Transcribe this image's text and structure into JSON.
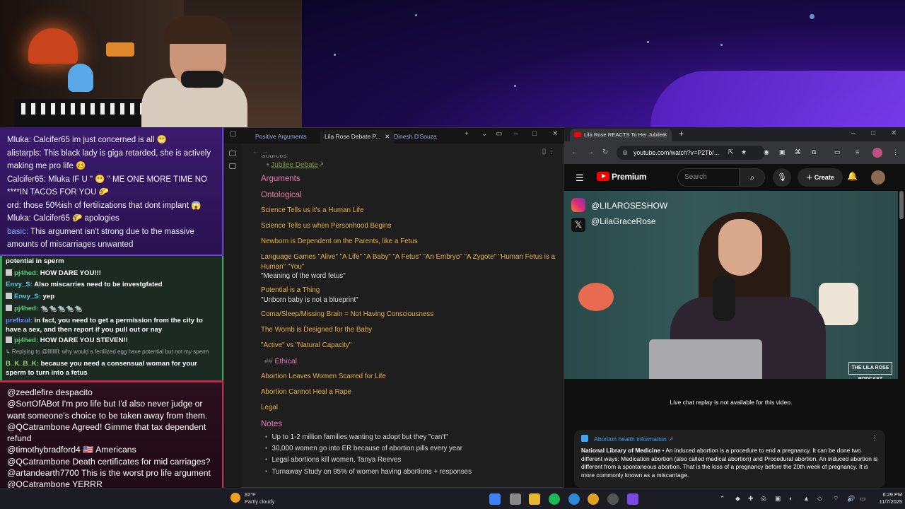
{
  "chat_top": {
    "lines": [
      {
        "user": "Mluka:",
        "text": "Calcifer65 im just concerned is all 😬"
      },
      {
        "user": "alistarpls:",
        "text": "This black lady is giga retarded, she is actively making me pro life 🥴"
      },
      {
        "user": "Calcifer65:",
        "text": "Mluka IF U \" 😬 \" ME ONE MORE TIME NO ****IN TACOS FOR YOU 🌮"
      },
      {
        "user": "ord:",
        "text": "those 50%ish of fertilizations that dont implant 😱"
      },
      {
        "user": "Mluka:",
        "text": "Calcifer65 🌮 apologies"
      },
      {
        "user": "basic:",
        "text": "This argument isn't strong due to the massive amounts of miscarriages unwanted"
      }
    ]
  },
  "chat_mid": {
    "header": "potential in sperm",
    "lines": [
      {
        "user": "pj4hed:",
        "text": "HOW DARE YOU!!!"
      },
      {
        "user": "Envy_S:",
        "text": "Also miscarries need to be investgfated"
      },
      {
        "user": "Envy_S:",
        "text": "yep"
      },
      {
        "user": "pj4hed:",
        "text": "🐀🐀🐀🐀🐀"
      },
      {
        "user": "prefixui:",
        "text": "in fact, you need to get a permission from the city to have a sex, and then report if you pull out or nay"
      },
      {
        "user": "pj4hed:",
        "text": "HOW DARE YOU STEVEN!!"
      },
      {
        "user": "",
        "text": "↳ Replying to @lllllllll: why would a fertilized egg have potential but not my sperm"
      },
      {
        "user": "B_K_B_K:",
        "text": "because you need a consensual woman for your sperm to turn into a fetus"
      }
    ]
  },
  "chat_bottom": {
    "lines": [
      {
        "user": "@zeedlefire",
        "text": "despacito"
      },
      {
        "user": "@SortOfABot",
        "text": "I'm pro life but I'd also never judge or want someone's choice to be taken away from them."
      },
      {
        "user": "@QCatrambone",
        "text": "Agreed! Gimme that tax dependent refund"
      },
      {
        "user": "@timothybradford4",
        "text": "🇺🇸 Americans"
      },
      {
        "user": "@QCatrambone",
        "text": "Death certificates for mid carriages?"
      },
      {
        "user": "@artandearth7700",
        "text": "This is the worst pro life argument"
      },
      {
        "user": "@QCatrambone",
        "text": "YERRR"
      }
    ]
  },
  "obsidian": {
    "tabs": [
      "Positive Arguments",
      "Lila Rose Debate P...",
      "Dinesh D'Souza"
    ],
    "sources_heading": "Sources",
    "source_link": "Jubilee Debate",
    "arguments_heading": "Arguments",
    "ontological_heading": "Ontological",
    "items": [
      "Science Tells us it's a Human Life",
      "Science Tells us when Personhood Begins",
      "Newborn is Dependent on the Parents, like a Fetus"
    ],
    "language_games": "Language Games \"Alive\" \"A Life\" \"A Baby\" \"A Fetus\" \"An Embryo\" \"A Zygote\" \"Human Fetus is a Human\" \"You\"",
    "language_games_sub": "\"Meaning of the word fetus\"",
    "potential": "Potential is a Thing",
    "potential_sub": "\"Unborn baby is not a blueprint\"",
    "items2": [
      "Coma/Sleep/Missing Brain = Not Having Consciousness",
      "The Womb is Designed for the Baby",
      "\"Active\" vs \"Natural Capacity\""
    ],
    "ethical_prefix": "##",
    "ethical_heading": "Ethical",
    "ethical_items": [
      "Abortion Leaves Women Scarred for Life",
      "Abortion Cannot Heal a Rape"
    ],
    "legal_heading": "Legal",
    "notes_heading": "Notes",
    "notes": [
      "Up to 1-2 million families wanting to adopt but they \"can't\"",
      "30,000 women go into ER because of abortion pills every year",
      "Legal abortions kill women, Tanya Reeves",
      "Turnaway Study on 95% of women having abortions + responses"
    ]
  },
  "chrome": {
    "tab_title": "Lila Rose REACTS To Her Jubilee",
    "url": "youtube.com/watch?v=P2Tb/...",
    "yt_brand": "Premium",
    "search_placeholder": "Search",
    "create_label": "Create",
    "video_handles": [
      "@LILAROSESHOW",
      "@LilaGraceRose"
    ],
    "video_logo": "THE LILA ROSE PODCAST",
    "live_chat_note": "Live chat replay is not available for this video.",
    "info_title": "Abortion health information ↗",
    "info_source": "National Library of Medicine",
    "info_text": " • An induced abortion is a procedure to end a pregnancy. It can be done two different ways: Medication abortion (also called medical abortion) and Procedural abortion. An induced abortion is different from a spontaneous abortion. That is the loss of a pregnancy before the 20th week of pregnancy. It is more commonly known as a miscarriage."
  },
  "taskbar": {
    "temp": "82°F",
    "weather": "Partly cloudy",
    "time": "6:29 PM",
    "date": "11/7/2025"
  }
}
